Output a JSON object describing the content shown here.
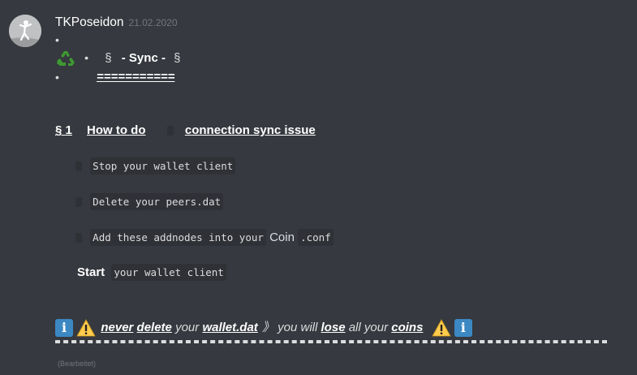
{
  "message": {
    "username": "TKPoseidon",
    "timestamp": "21.02.2020",
    "bullet": "•",
    "recycle_emoji": "♻️",
    "section_mark": "§",
    "title": "- Sync -",
    "equals_line": "==========="
  },
  "section": {
    "number": "§ 1",
    "how_to": "How to do",
    "issue": "connection sync issue"
  },
  "steps": [
    {
      "code": "Stop your wallet client"
    },
    {
      "code": "Delete your peers.dat"
    },
    {
      "code": "Add these addnodes into your",
      "plain": "Coin",
      "code_tail": ".conf"
    },
    {
      "bold": "Start",
      "code": "your wallet client"
    }
  ],
  "warning": {
    "info_icon": "i",
    "never": "never",
    "delete": "delete",
    "your": "your",
    "wallet_dat": "wallet.dat",
    "arrow": "》",
    "you_will": "you will",
    "lose": "lose",
    "all_your": "all your",
    "coins": "coins"
  },
  "edited_label": "(Bearbeitet)",
  "colors": {
    "background": "#36393f",
    "text": "#dcddde",
    "username": "#ffffff",
    "timestamp": "#72767d",
    "code_bg": "#2f3136",
    "info_blue": "#3b88c3",
    "warning_yellow": "#ffcc4d"
  },
  "icons": {
    "recycle": "recycle-icon",
    "info": "info-icon",
    "warning": "warning-icon",
    "avatar": "avatar"
  }
}
